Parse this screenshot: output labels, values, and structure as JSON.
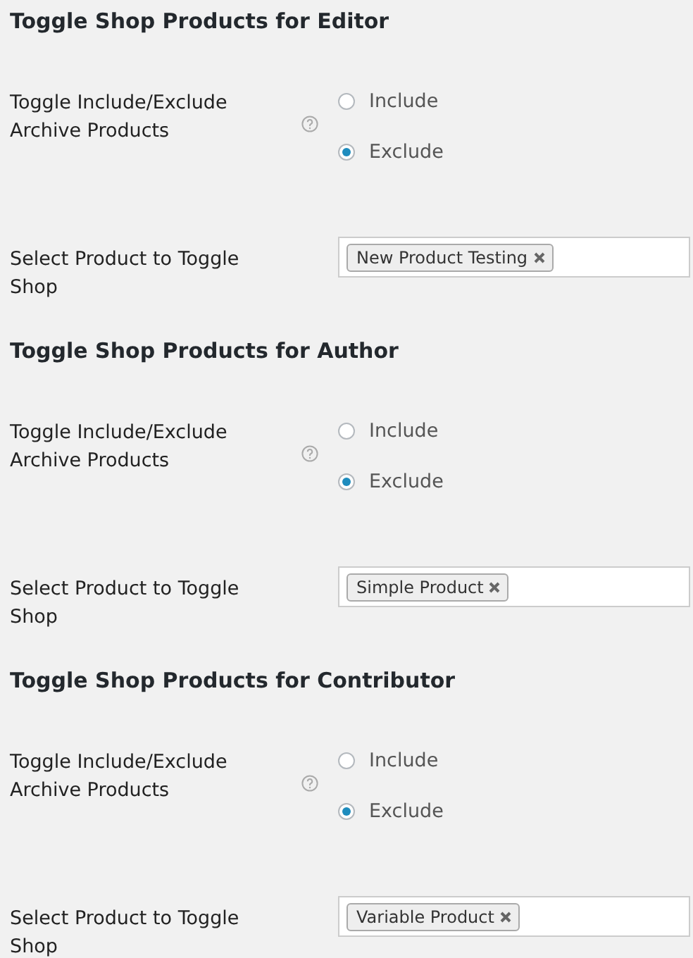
{
  "sections": [
    {
      "title": "Toggle Shop Products for Editor",
      "toggle_label": "Toggle Include/Exclude Archive Products",
      "options": [
        {
          "label": "Include",
          "selected": false
        },
        {
          "label": "Exclude",
          "selected": true
        }
      ],
      "select_label": "Select Product to Toggle Shop",
      "tags": [
        "New Product Testing"
      ]
    },
    {
      "title": "Toggle Shop Products for Author",
      "toggle_label": "Toggle Include/Exclude Archive Products",
      "options": [
        {
          "label": "Include",
          "selected": false
        },
        {
          "label": "Exclude",
          "selected": true
        }
      ],
      "select_label": "Select Product to Toggle Shop",
      "tags": [
        "Simple Product"
      ]
    },
    {
      "title": "Toggle Shop Products for Contributor",
      "toggle_label": "Toggle Include/Exclude Archive Products",
      "options": [
        {
          "label": "Include",
          "selected": false
        },
        {
          "label": "Exclude",
          "selected": true
        }
      ],
      "select_label": "Select Product to Toggle Shop",
      "tags": [
        "Variable Product"
      ]
    }
  ]
}
